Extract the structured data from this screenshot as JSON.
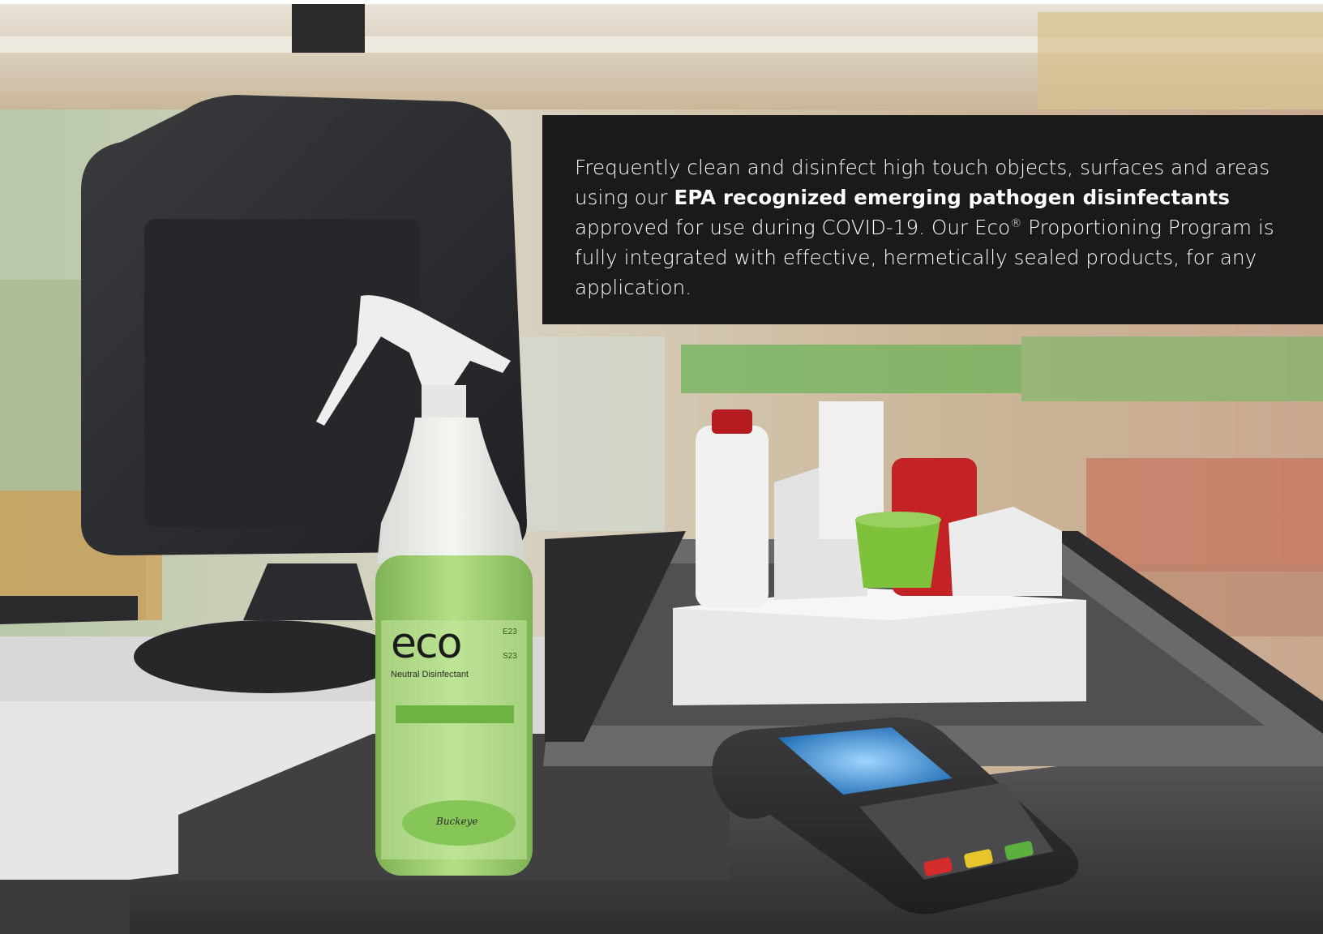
{
  "caption": {
    "text_before": "Frequently clean and disinfect high touch objects, surfaces and areas using our ",
    "emphasis": "EPA recognized emerging pathogen disinfectants",
    "text_middle": " approved for use during COVID-19. Our Eco",
    "registered_mark": "®",
    "text_after": " Proportioning Program is fully integrated with effective, hermetically sealed products, for any application."
  },
  "bottle_label": {
    "brand": "eco",
    "product": "Neutral Disinfectant",
    "code_1": "E23",
    "code_2": "S23",
    "maker": "Buckeye"
  },
  "colors": {
    "caption_bg": "#1a1a1a",
    "caption_text": "#ffffff",
    "liquid_green": "#9ccc6a",
    "counter_dark": "#3b3b3d",
    "terminal_screen": "#2c7fc4"
  }
}
